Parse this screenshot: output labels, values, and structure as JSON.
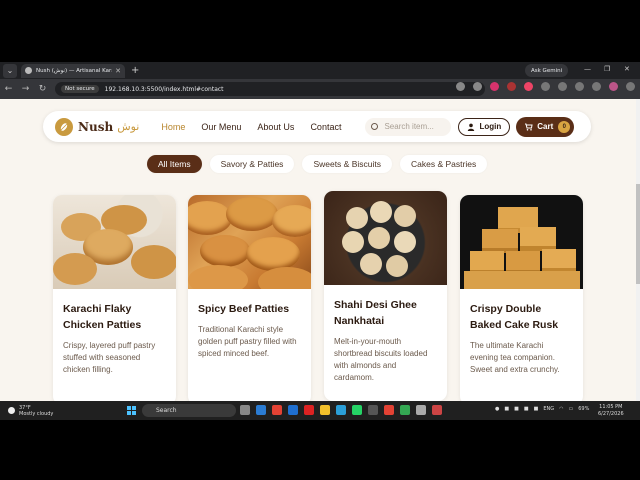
{
  "browser": {
    "tab_title": "Nush (نوش) — Artisanal Karachi B",
    "gemini_label": "Ask Gemini",
    "not_secure": "Not secure",
    "url": "192.168.10.3:5500/index.html#contact"
  },
  "site": {
    "logo_text": "Nush",
    "logo_urdu": "نوش",
    "nav": [
      "Home",
      "Our Menu",
      "About Us",
      "Contact"
    ],
    "search_placeholder": "Search item...",
    "login_label": "Login",
    "cart_label": "Cart",
    "cart_count": "0"
  },
  "filters": [
    "All Items",
    "Savory & Patties",
    "Sweets & Biscuits",
    "Cakes & Pastries"
  ],
  "products": [
    {
      "title": "Karachi Flaky Chicken Patties",
      "desc": "Crispy, layered puff pastry stuffed with seasoned chicken filling."
    },
    {
      "title": "Spicy Beef Patties",
      "desc": "Traditional Karachi style golden puff pastry filled with spiced minced beef."
    },
    {
      "title": "Shahi Desi Ghee Nankhatai",
      "desc": "Melt-in-your-mouth shortbread biscuits loaded with almonds and cardamom."
    },
    {
      "title": "Crispy Double Baked Cake Rusk",
      "desc": "The ultimate Karachi evening tea companion. Sweet and extra crunchy."
    }
  ],
  "taskbar": {
    "weather_temp": "37°F",
    "weather_desc": "Mostly cloudy",
    "search_label": "Search",
    "lang": "ENG",
    "battery": "69%",
    "time": "11:05 PM",
    "date": "6/27/2026"
  },
  "colors": {
    "accent": "#5a2e17",
    "gold": "#c99a3f",
    "page_bg": "#f9f5ef"
  }
}
